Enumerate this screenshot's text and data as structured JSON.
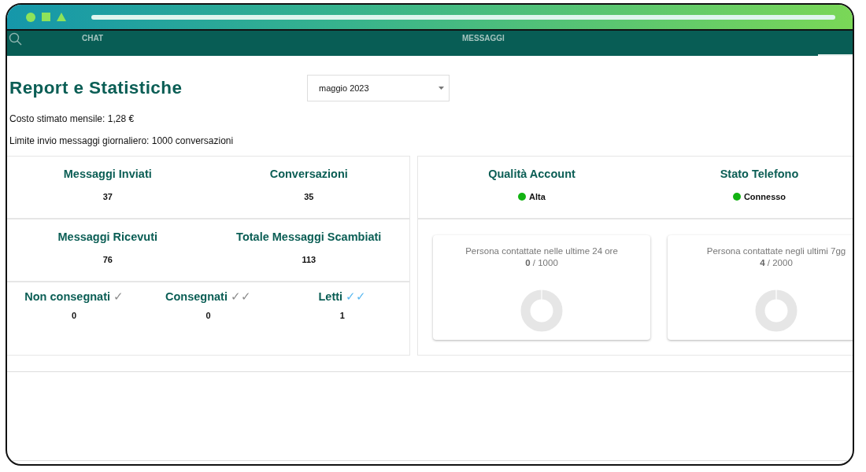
{
  "tabs": [
    {
      "label": "CHAT",
      "selected": false
    },
    {
      "label": "MESSAGGI",
      "selected": false
    },
    {
      "selected": true
    }
  ],
  "title": "Report e Statistiche",
  "month_select": {
    "value": "maggio 2023"
  },
  "info_lines": [
    "Costo stimato mensile: 1,28 €",
    "Limite invio messaggi giornaliero: 1000 conversazioni"
  ],
  "stats": [
    {
      "label": "Messaggi Inviati",
      "value": "37"
    },
    {
      "label": "Conversazioni",
      "value": "35"
    },
    {
      "label": "Messaggi Ricevuti",
      "value": "76"
    },
    {
      "label": "Totale Messaggi Scambiati",
      "value": "113"
    }
  ],
  "delivery": [
    {
      "label": "Non consegnati",
      "check": "✓",
      "color": "#8a8a8a",
      "value": "0"
    },
    {
      "label": "Consegnati",
      "check": "✓✓",
      "color": "#8a8a8a",
      "value": "0"
    },
    {
      "label": "Letti",
      "check": "✓✓",
      "color": "#5ab8f0",
      "value": "1"
    }
  ],
  "status": [
    {
      "label": "Qualità Account",
      "value": "Alta",
      "color": "#12b312"
    },
    {
      "label": "Stato Telefono",
      "value": "Connesso",
      "color": "#12b312"
    }
  ],
  "usage_cards": [
    {
      "title": "Persona contattate nelle ultime 24 ore",
      "used": "0",
      "limit": "/ 1000"
    },
    {
      "title": "Persona contattate negli ultimi 7gg",
      "used": "4",
      "limit": "/ 2000"
    }
  ]
}
